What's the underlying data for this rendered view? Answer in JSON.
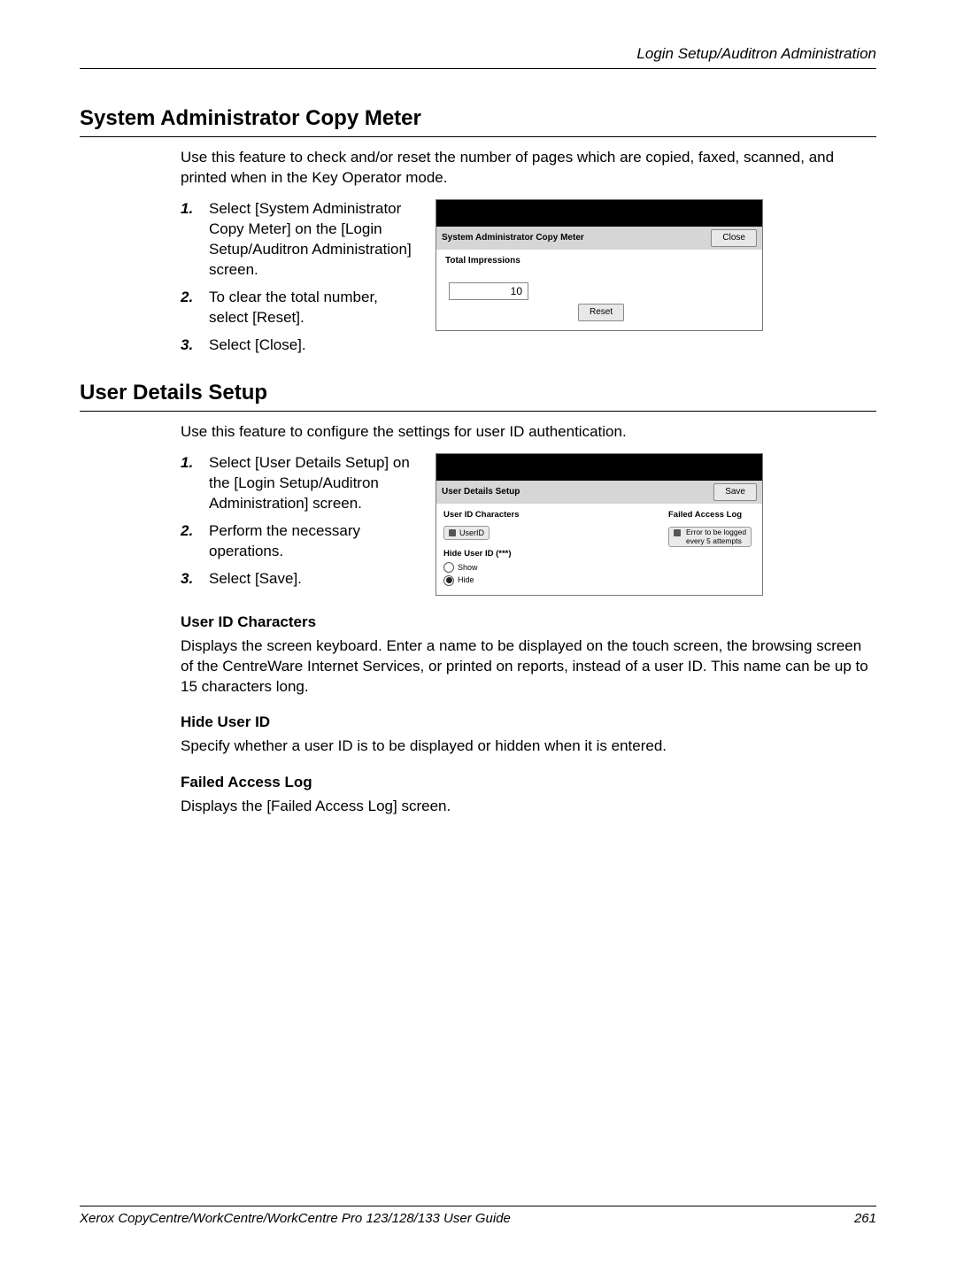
{
  "header": {
    "breadcrumb": "Login Setup/Auditron Administration"
  },
  "section1": {
    "heading": "System Administrator Copy Meter",
    "intro": "Use this feature to check and/or reset the number of pages which are copied, faxed, scanned, and printed when in the Key Operator mode.",
    "steps": [
      "Select [System Administrator Copy Meter] on the [Login Setup/Auditron Administration] screen.",
      "To clear the total number, select [Reset].",
      "Select [Close]."
    ]
  },
  "shot1": {
    "title": "System Administrator Copy Meter",
    "close_label": "Close",
    "total_label": "Total Impressions",
    "total_value": "10",
    "reset_label": "Reset"
  },
  "section2": {
    "heading": "User Details Setup",
    "intro": "Use this feature to configure the settings for user ID authentication.",
    "steps": [
      "Select [User Details Setup] on the  [Login Setup/Auditron Administration] screen.",
      "Perform the necessary operations.",
      "Select [Save]."
    ]
  },
  "shot2": {
    "title": "User Details Setup",
    "save_label": "Save",
    "uid_chars_label": "User ID Characters",
    "uid_btn_label": "UserID",
    "hide_label": "Hide User ID (***)",
    "radio_show": "Show",
    "radio_hide": "Hide",
    "fal_label": "Failed Access Log",
    "fal_text_line1": "Error to be logged",
    "fal_text_line2": "every 5 attempts"
  },
  "subsections": {
    "uid_heading": "User ID Characters",
    "uid_body": "Displays the screen keyboard. Enter a name to be displayed on the touch screen, the browsing screen of the CentreWare Internet Services, or printed on reports, instead of a user ID. This name can be up to 15 characters long.",
    "hide_heading": "Hide User ID",
    "hide_body": "Specify whether a user ID is to be displayed or hidden when it is entered.",
    "fal_heading": "Failed Access Log",
    "fal_body": "Displays the [Failed Access Log] screen."
  },
  "footer": {
    "guide": "Xerox CopyCentre/WorkCentre/WorkCentre Pro 123/128/133 User Guide",
    "page_no": "261"
  }
}
